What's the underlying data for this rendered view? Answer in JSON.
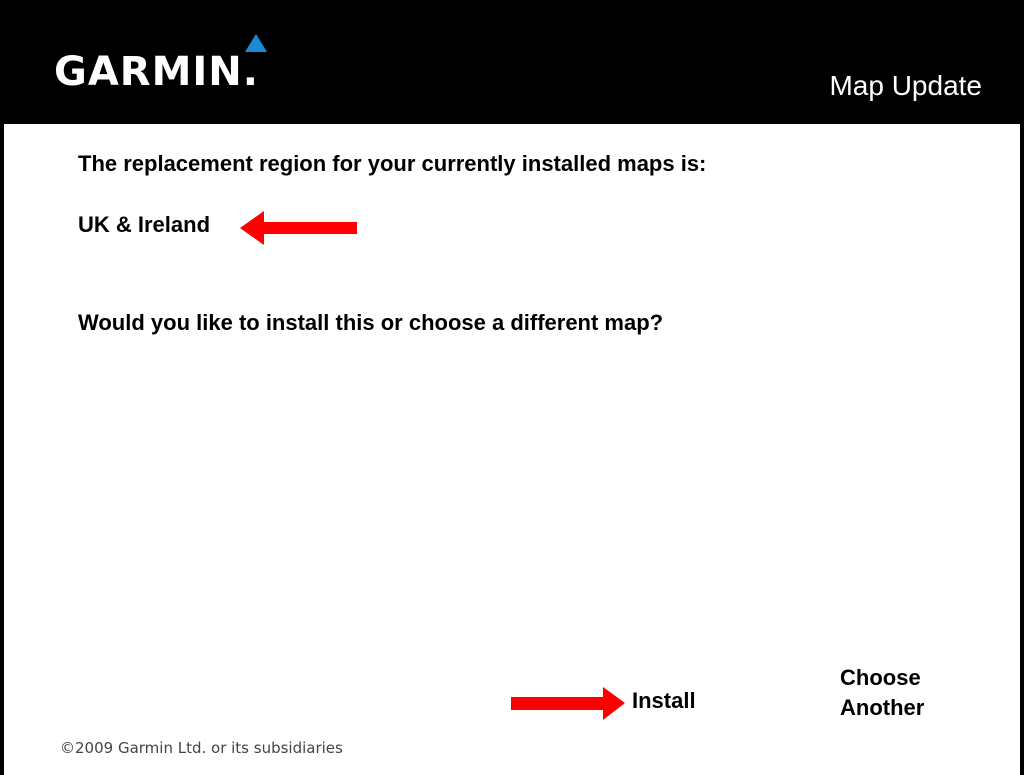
{
  "header": {
    "logo_text": "GARMIN.",
    "title": "Map Update"
  },
  "main": {
    "prompt": "The replacement region for your currently installed maps is:",
    "region": "UK & Ireland",
    "question": "Would you like to install this or choose a different map?"
  },
  "actions": {
    "install_label": "Install",
    "choose_line1": "Choose",
    "choose_line2": "Another"
  },
  "footer": {
    "copyright": "©2009 Garmin Ltd. or its subsidiaries"
  },
  "colors": {
    "header_bg": "#000000",
    "logo_delta": "#1a8ad4",
    "annotation_arrow": "#ff0000",
    "text": "#000000"
  },
  "icons": {
    "logo_mark": "garmin-delta-icon",
    "annotation": "red-arrow-icon"
  }
}
